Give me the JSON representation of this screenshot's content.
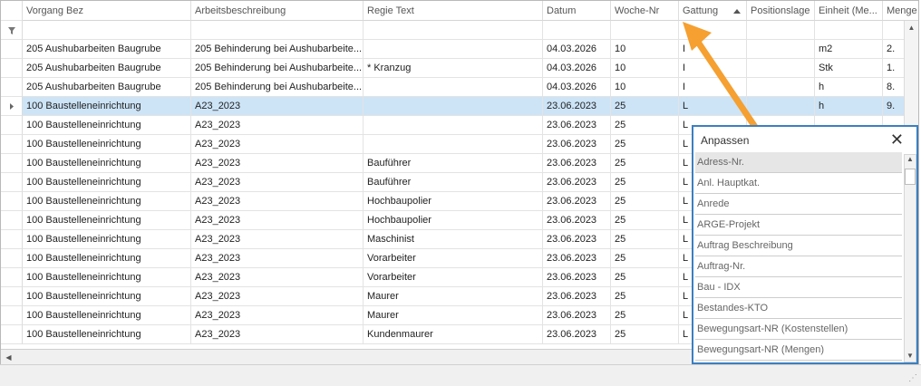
{
  "columns": [
    "Vorgang Bez",
    "Arbeitsbeschreibung",
    "Regie Text",
    "Datum",
    "Woche-Nr",
    "Gattung",
    "Positionslage",
    "Einheit (Me...",
    "Menge"
  ],
  "rows": [
    [
      "205 Aushubarbeiten Baugrube",
      "205 Behinderung bei Aushubarbeite...",
      "",
      "04.03.2026",
      "10",
      "I",
      "",
      "m2",
      "2."
    ],
    [
      "205 Aushubarbeiten Baugrube",
      "205 Behinderung bei Aushubarbeite...",
      "* Kranzug",
      "04.03.2026",
      "10",
      "I",
      "",
      "Stk",
      "1."
    ],
    [
      "205 Aushubarbeiten Baugrube",
      "205 Behinderung bei Aushubarbeite...",
      "",
      "04.03.2026",
      "10",
      "I",
      "",
      "h",
      "8."
    ],
    [
      "100 Baustelleneinrichtung",
      "A23_2023",
      "",
      "23.06.2023",
      "25",
      "L",
      "",
      "h",
      "9."
    ],
    [
      "100 Baustelleneinrichtung",
      "A23_2023",
      "",
      "23.06.2023",
      "25",
      "L",
      "",
      "",
      ""
    ],
    [
      "100 Baustelleneinrichtung",
      "A23_2023",
      "",
      "23.06.2023",
      "25",
      "L",
      "",
      "",
      ""
    ],
    [
      "100 Baustelleneinrichtung",
      "A23_2023",
      "Bauführer",
      "23.06.2023",
      "25",
      "L",
      "",
      "",
      ""
    ],
    [
      "100 Baustelleneinrichtung",
      "A23_2023",
      "Bauführer",
      "23.06.2023",
      "25",
      "L",
      "",
      "",
      ""
    ],
    [
      "100 Baustelleneinrichtung",
      "A23_2023",
      "Hochbaupolier",
      "23.06.2023",
      "25",
      "L",
      "",
      "",
      ""
    ],
    [
      "100 Baustelleneinrichtung",
      "A23_2023",
      "Hochbaupolier",
      "23.06.2023",
      "25",
      "L",
      "",
      "",
      ""
    ],
    [
      "100 Baustelleneinrichtung",
      "A23_2023",
      "Maschinist",
      "23.06.2023",
      "25",
      "L",
      "",
      "",
      ""
    ],
    [
      "100 Baustelleneinrichtung",
      "A23_2023",
      "Vorarbeiter",
      "23.06.2023",
      "25",
      "L",
      "",
      "",
      ""
    ],
    [
      "100 Baustelleneinrichtung",
      "A23_2023",
      "Vorarbeiter",
      "23.06.2023",
      "25",
      "L",
      "",
      "",
      ""
    ],
    [
      "100 Baustelleneinrichtung",
      "A23_2023",
      "Maurer",
      "23.06.2023",
      "25",
      "L",
      "",
      "",
      ""
    ],
    [
      "100 Baustelleneinrichtung",
      "A23_2023",
      "Maurer",
      "23.06.2023",
      "25",
      "L",
      "",
      "",
      ""
    ],
    [
      "100 Baustelleneinrichtung",
      "A23_2023",
      "Kundenmaurer",
      "23.06.2023",
      "25",
      "L",
      "",
      "",
      ""
    ]
  ],
  "selected_row": 3,
  "customize": {
    "title": "Anpassen",
    "items": [
      "Adress-Nr.",
      "Anl. Hauptkat.",
      "Anrede",
      "ARGE-Projekt",
      "Auftrag Beschreibung",
      "Auftrag-Nr.",
      "Bau - IDX",
      "Bestandes-KTO",
      "Bewegungsart-NR (Kostenstellen)",
      "Bewegungsart-NR (Mengen)"
    ]
  },
  "colors": {
    "selected": "#cde4f7",
    "panel_border": "#3c7fc0",
    "arrow": "#f5a030"
  }
}
